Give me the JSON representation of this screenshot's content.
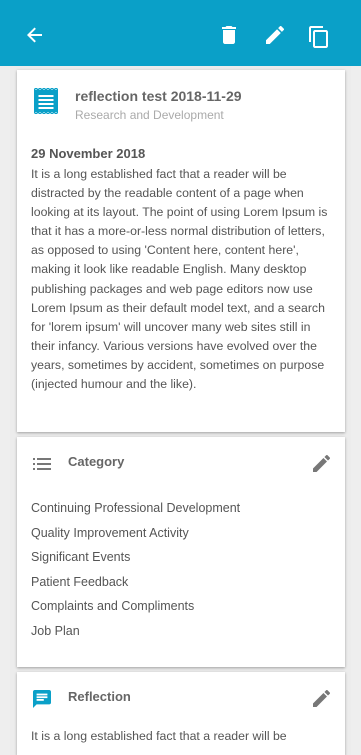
{
  "colors": {
    "appbar": "#0aa0c8",
    "accent": "#0aa0c8",
    "icon_grey": "#777777"
  },
  "toolbar": {
    "back_icon": "arrow-back-icon",
    "delete_icon": "delete-icon",
    "edit_icon": "edit-icon",
    "copy_icon": "copy-icon"
  },
  "entry": {
    "icon": "document-icon",
    "title": "reflection test 2018-11-29",
    "subtitle": "Research and Development",
    "date": "29 November 2018",
    "body": "It is a long established fact that a reader will be distracted by the readable content of a page when looking at its layout. The point of using Lorem Ipsum is that it has a more-or-less normal distribution of letters, as opposed to using 'Content here, content here', making it look like readable English. Many desktop publishing packages and web page editors now use Lorem Ipsum as their default model text, and a search for 'lorem ipsum' will uncover many web sites still in their infancy. Various versions have evolved over the years, sometimes by accident, sometimes on purpose (injected humour and the like)."
  },
  "category": {
    "icon": "list-icon",
    "title": "Category",
    "items": [
      "Continuing Professional Development",
      "Quality Improvement Activity",
      "Significant Events",
      "Patient Feedback",
      "Complaints and Compliments",
      "Job Plan"
    ]
  },
  "reflection": {
    "icon": "comment-icon",
    "title": "Reflection",
    "preview": "It is a long established fact that a reader will be"
  }
}
